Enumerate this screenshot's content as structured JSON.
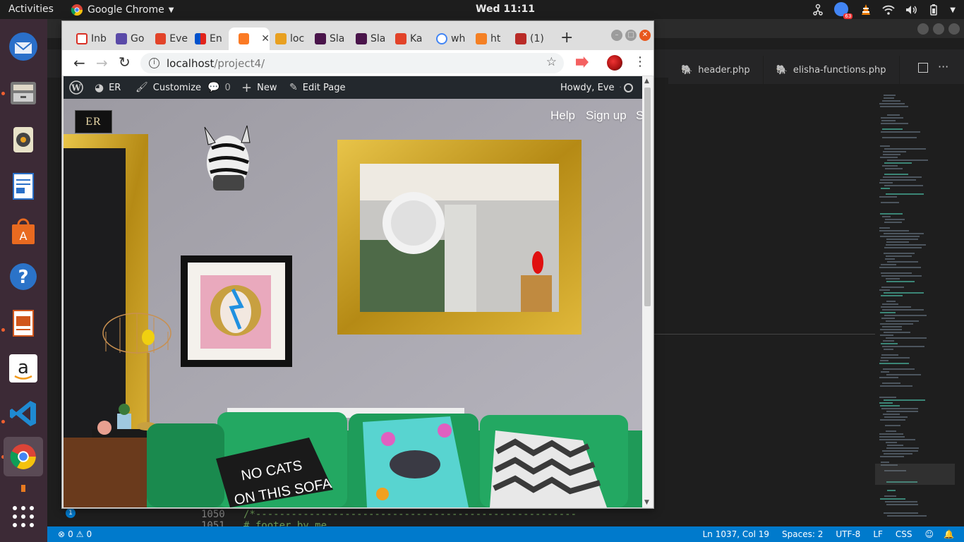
{
  "topbar": {
    "activities": "Activities",
    "app_name": "Google Chrome",
    "clock": "Wed 11:11",
    "chrome_badge": "63"
  },
  "dock": {
    "items": [
      "thunderbird-icon",
      "files-icon",
      "rhythmbox-icon",
      "writer-icon",
      "software-center-icon",
      "help-icon",
      "impress-icon",
      "amazon-icon",
      "vscode-icon",
      "chrome-icon"
    ],
    "notification_count": "1"
  },
  "vscode": {
    "tabs": [
      {
        "label": "header.php"
      },
      {
        "label": "elisha-functions.php"
      }
    ],
    "code_line_number": "1050",
    "code_line_text": "/*------------------------------------------------------",
    "code_line2_number": "1051",
    "code_line2_text": "# footer by me",
    "status": {
      "problems": "0",
      "warnings": "0",
      "position": "Ln 1037, Col 19",
      "spaces": "Spaces: 2",
      "encoding": "UTF-8",
      "eol": "LF",
      "language": "CSS"
    }
  },
  "chrome": {
    "tabs": [
      {
        "label": "Inb",
        "icon": "gmail-icon"
      },
      {
        "label": "Go",
        "icon": "calendar-icon"
      },
      {
        "label": "Eve",
        "icon": "gitlab-icon"
      },
      {
        "label": "En",
        "icon": "trello-icon"
      },
      {
        "label": "",
        "icon": "xampp-icon"
      },
      {
        "label": "loc",
        "icon": "lamp-icon"
      },
      {
        "label": "Sla",
        "icon": "slack-icon"
      },
      {
        "label": "Sla",
        "icon": "slack-icon"
      },
      {
        "label": "Ka",
        "icon": "gitlab-icon"
      },
      {
        "label": "wh",
        "icon": "google-icon"
      },
      {
        "label": "ht",
        "icon": "stackoverflow-icon"
      },
      {
        "label": "(1)",
        "icon": "quora-icon"
      }
    ],
    "new_tab": "+",
    "url_host": "localhost",
    "url_path": "/project4/"
  },
  "wp_admin_bar": {
    "site_name": "ER",
    "customize": "Customize",
    "comments": "0",
    "new": "New",
    "edit_page": "Edit Page",
    "howdy": "Howdy, Eve"
  },
  "site": {
    "logo": "ER",
    "nav": [
      "Help",
      "Sign up",
      "S"
    ],
    "pillow_text_1": "NO CATS",
    "pillow_text_2": "ON THIS SOFA"
  },
  "colors": {
    "wall": "#b1aeb5",
    "sofa": "#1f9a58",
    "gold": "#c9a227",
    "wp_bar": "#23282d",
    "vscode_status": "#007acc"
  }
}
